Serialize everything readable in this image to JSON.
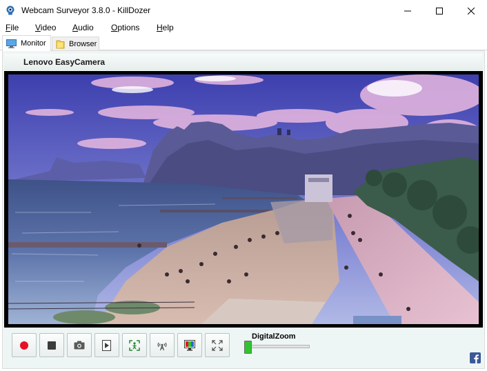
{
  "window": {
    "title": "Webcam Surveyor 3.8.0 - KillDozer"
  },
  "menu": [
    {
      "key": "F",
      "rest": "ile"
    },
    {
      "key": "V",
      "rest": "ideo"
    },
    {
      "key": "A",
      "rest": "udio"
    },
    {
      "key": "O",
      "rest": "ptions"
    },
    {
      "key": "H",
      "rest": "elp"
    }
  ],
  "tabs": [
    {
      "label": "Monitor",
      "icon": "monitor-icon",
      "active": true
    },
    {
      "label": "Browser",
      "icon": "folder-icon",
      "active": false
    }
  ],
  "camera": {
    "name": "Lenovo EasyCamera"
  },
  "controls": {
    "buttons": [
      {
        "name": "record",
        "icon": "record-icon"
      },
      {
        "name": "stop",
        "icon": "stop-icon"
      },
      {
        "name": "snapshot",
        "icon": "camera-icon"
      },
      {
        "name": "playback",
        "icon": "play-file-icon"
      },
      {
        "name": "motion-detect",
        "icon": "motion-detect-icon"
      },
      {
        "name": "broadcast",
        "icon": "broadcast-icon"
      },
      {
        "name": "video-settings",
        "icon": "color-settings-icon"
      },
      {
        "name": "fullscreen",
        "icon": "fullscreen-icon"
      }
    ],
    "zoom_label": "DigitalZoom",
    "zoom_value": 0
  },
  "colors": {
    "accent": "#0078d7",
    "panel_bg": "#eef6f5",
    "record_red": "#e81123",
    "zoom_thumb": "#2ec52e",
    "facebook": "#3b5998"
  }
}
